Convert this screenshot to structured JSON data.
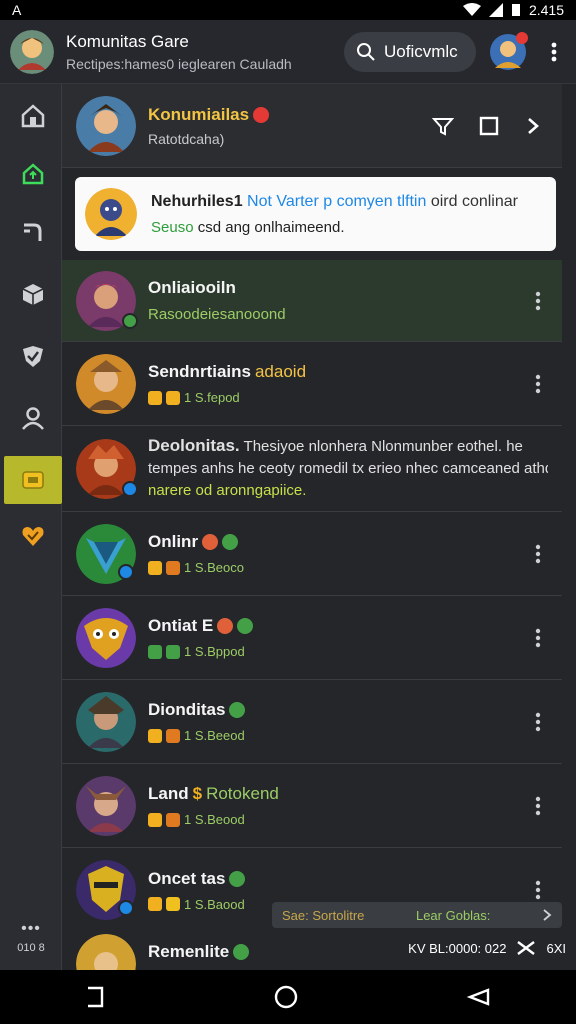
{
  "status_bar": {
    "left_glyph": "A",
    "time": "2.415"
  },
  "app": {
    "title": "Komunitas Gare",
    "subtitle": "Rectipes:hames0 ieglearen Cauladh",
    "search_label": "Uoficvmlc"
  },
  "sidebar": {
    "icons": [
      "home-icon",
      "upload-icon",
      "route-icon",
      "box-icon",
      "shield-check-icon",
      "user-icon",
      "chat-icon",
      "heart-icon"
    ],
    "active_index": 6,
    "footer_dots": "•••",
    "footer_label": "010 8"
  },
  "header_card": {
    "title": "Konumiailas",
    "subtitle": "Ratotdcaha)"
  },
  "notice": {
    "line1_a": "Nehurhiles1",
    "line1_b": "Not Varter p comyen tlftin",
    "line1_c": "oird conlinar",
    "line2_a": "Seuso",
    "line2_b": "csd ang onlhaimeend."
  },
  "rows": [
    {
      "title": "Onliaiooiln",
      "meta": "Rasoodeiesanooond",
      "type": "simple"
    },
    {
      "title": "Sendnrtiains",
      "title_tag": "adaoid",
      "meta": "1 S.fepod",
      "type": "meta"
    },
    {
      "title": "Deolonitas.",
      "desc1": "Thesiyoe nlonhera Nlonmunber eothel. he",
      "desc2": "tempes anhs he ceoty romedil tx erieo nhec camceaned athd",
      "desc3": "narere od aronngapiice.",
      "type": "desc"
    },
    {
      "title": "Onlinr",
      "meta": "1 S.Beoco",
      "type": "meta"
    },
    {
      "title": "Ontiat E",
      "meta": "1 S.Bppod",
      "type": "meta"
    },
    {
      "title": "Dionditas",
      "meta": "1 S.Beeod",
      "type": "meta"
    },
    {
      "title": "Land",
      "title_tag": "Rotokend",
      "meta": "1 S.Beood",
      "type": "meta"
    },
    {
      "title": "Oncet tas",
      "meta": "1 S.Baood",
      "type": "meta"
    },
    {
      "title": "Remenlite",
      "type": "simple"
    }
  ],
  "overlay": {
    "left": "Sae: Sortolitre",
    "right": "Lear Goblas:"
  },
  "footer_status": {
    "text": "KV BL:0000: 022",
    "icon_label": "6XI"
  },
  "colors": {
    "accent_yellow": "#f3c343",
    "accent_green": "#9ccc65",
    "link_blue": "#1e88e5",
    "active_sidebar": "#b8b82c"
  }
}
